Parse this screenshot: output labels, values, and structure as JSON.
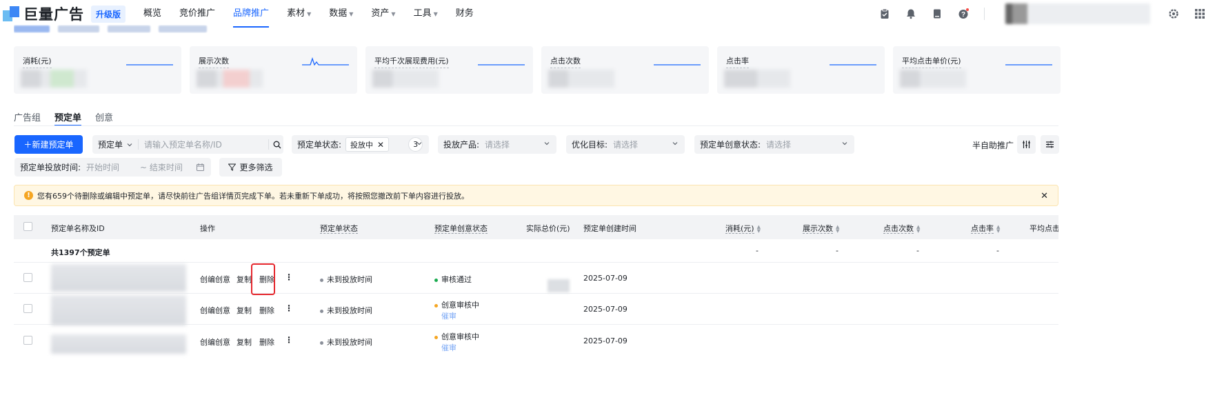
{
  "brand": {
    "logo_text": "巨量广告",
    "badge": "升级版"
  },
  "nav": {
    "items": [
      {
        "label": "概览",
        "dropdown": false,
        "active": false
      },
      {
        "label": "竞价推广",
        "dropdown": false,
        "active": false
      },
      {
        "label": "品牌推广",
        "dropdown": false,
        "active": true
      },
      {
        "label": "素材",
        "dropdown": true,
        "active": false
      },
      {
        "label": "数据",
        "dropdown": true,
        "active": false
      },
      {
        "label": "资产",
        "dropdown": true,
        "active": false
      },
      {
        "label": "工具",
        "dropdown": true,
        "active": false
      },
      {
        "label": "财务",
        "dropdown": false,
        "active": false
      }
    ],
    "right_icons": [
      "clipboard-icon",
      "bell-icon",
      "document-icon",
      "help-icon",
      "settings-icon",
      "apps-grid-icon"
    ]
  },
  "metrics": [
    {
      "title": "消耗(元)"
    },
    {
      "title": "展示次数"
    },
    {
      "title": "平均千次展现费用(元)"
    },
    {
      "title": "点击次数"
    },
    {
      "title": "点击率"
    },
    {
      "title": "平均点击单价(元)"
    }
  ],
  "tabs": [
    {
      "label": "广告组",
      "active": false
    },
    {
      "label": "预定单",
      "active": true
    },
    {
      "label": "创意",
      "active": false
    }
  ],
  "toolbar": {
    "new_button": "＋新建预定单",
    "search_type": "预定单",
    "search_placeholder": "请输入预定单名称/ID",
    "status_label": "预定单状态:",
    "status_tag": "投放中",
    "status_count": "3",
    "product_label": "投放产品:",
    "product_placeholder": "请选择",
    "goal_label": "优化目标:",
    "goal_placeholder": "请选择",
    "creative_status_label": "预定单创意状态:",
    "creative_status_placeholder": "请选择",
    "semi_auto": "半自助推广",
    "time_label": "预定单投放时间:",
    "start_placeholder": "开始时间",
    "end_placeholder": "~ 结束时间",
    "more_filters": "更多筛选"
  },
  "alert": {
    "text": "您有659个待删除或编辑中预定单，请尽快前往广告组详情页完成下单。若未重新下单成功，将按照您撤改前下单内容进行投放。"
  },
  "table": {
    "columns": {
      "name": "预定单名称及ID",
      "actions": "操作",
      "status": "预定单状态",
      "creative_status": "预定单创意状态",
      "price": "实际总价(元)",
      "created": "预定单创建时间",
      "cost": "消耗(元)",
      "impressions": "展示次数",
      "clicks": "点击次数",
      "ctr": "点击率",
      "avg_click": "平均点击"
    },
    "summary": {
      "label": "共1397个预定单",
      "cost": "-",
      "impressions": "-",
      "clicks": "-",
      "ctr": "-"
    },
    "action_labels": {
      "edit": "创编创意",
      "copy": "复制",
      "delete": "删除"
    },
    "rows": [
      {
        "status": "未到投放时间",
        "status_color": "#8a8f99",
        "creative_status": "审核通过",
        "creative_color": "#1aab4f",
        "creative_sub": "",
        "created": "2025-07-09"
      },
      {
        "status": "未到投放时间",
        "status_color": "#8a8f99",
        "creative_status": "创意审核中",
        "creative_color": "#f5a623",
        "creative_sub": "催审",
        "created": "2025-07-09"
      },
      {
        "status": "未到投放时间",
        "status_color": "#8a8f99",
        "creative_status": "创意审核中",
        "creative_color": "#f5a623",
        "creative_sub": "催审",
        "created": "2025-07-09"
      }
    ]
  }
}
